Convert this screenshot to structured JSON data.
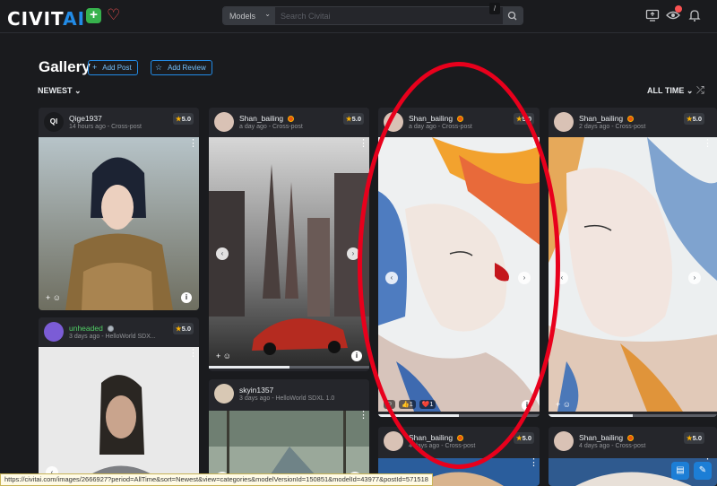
{
  "header": {
    "logo": "CIVIT",
    "logo_accent": "AI",
    "add_label": "+",
    "search_type": "Models",
    "search_placeholder": "Search Civitai",
    "search_shortcut": "/"
  },
  "page": {
    "title": "Gallery",
    "add_post": "Add Post",
    "add_review": "Add Review",
    "sort": "NEWEST",
    "period": "ALL TIME"
  },
  "cards": [
    {
      "user": "Qige1937",
      "avatar_text": "QI",
      "meta": "14 hours ago - Cross-post",
      "rating": "5.0"
    },
    {
      "user": "Shan_bailing",
      "meta": "a day ago - Cross-post",
      "rating": "5.0"
    },
    {
      "user": "Shan_bailing",
      "meta": "a day ago - Cross-post",
      "rating": "5.0",
      "reactions": [
        "☺",
        "👍1",
        "❤️1"
      ]
    },
    {
      "user": "Shan_bailing",
      "meta": "2 days ago - Cross-post",
      "rating": "5.0"
    },
    {
      "user": "unheaded",
      "meta": "3 days ago - HelloWorld SDX...",
      "rating": "5.0"
    },
    {
      "user": "skyin1357",
      "meta": "3 days ago - HelloWorld SDXL 1.0"
    },
    {
      "user": "Shan_bailing",
      "meta": "4 days ago - Cross-post",
      "rating": "5.0"
    },
    {
      "user": "Shan_bailing",
      "meta": "4 days ago - Cross-post",
      "rating": "5.0"
    }
  ],
  "status_url": "https://civitai.com/images/2666927?period=AllTime&sort=Newest&view=categories&modelVersionId=150851&modelId=43977&postId=571518",
  "colors": {
    "accent": "#228be6",
    "annotation": "#e8001c",
    "rating_star": "#fab005"
  }
}
